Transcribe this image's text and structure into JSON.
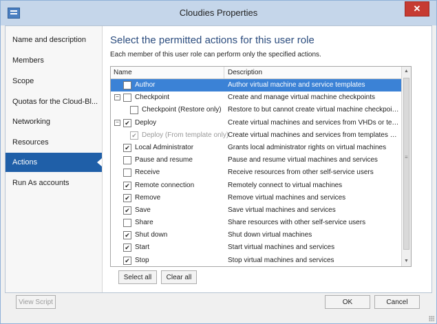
{
  "window": {
    "title": "Cloudies Properties"
  },
  "sidebar": {
    "items": [
      {
        "label": "Name and description",
        "active": false
      },
      {
        "label": "Members",
        "active": false
      },
      {
        "label": "Scope",
        "active": false
      },
      {
        "label": "Quotas for the Cloud-Bl...",
        "active": false
      },
      {
        "label": "Networking",
        "active": false
      },
      {
        "label": "Resources",
        "active": false
      },
      {
        "label": "Actions",
        "active": true
      },
      {
        "label": "Run As accounts",
        "active": false
      }
    ]
  },
  "main": {
    "heading": "Select the permitted actions for this user role",
    "subtext": "Each member of this user role can perform only the specified actions.",
    "table": {
      "columns": [
        "Name",
        "Description"
      ],
      "rows": [
        {
          "name": "Author",
          "description": "Author virtual machine and service templates",
          "checked": false,
          "selected": true
        },
        {
          "name": "Checkpoint",
          "description": "Create and manage virtual machine checkpoints",
          "checked": false,
          "expander": "minus"
        },
        {
          "name": "Checkpoint (Restore only)",
          "description": "Restore to but cannot create virtual machine checkpoints",
          "checked": false,
          "indent": true
        },
        {
          "name": "Deploy",
          "description": "Create virtual machines and services from VHDs or templat...",
          "checked": true,
          "expander": "minus"
        },
        {
          "name": "Deploy (From template only)",
          "description": "Create virtual machines and services from templates only",
          "checked": true,
          "indent": true,
          "disabled": true
        },
        {
          "name": "Local Administrator",
          "description": "Grants local administrator rights on virtual machines",
          "checked": true
        },
        {
          "name": "Pause and resume",
          "description": "Pause and resume virtual machines and services",
          "checked": false
        },
        {
          "name": "Receive",
          "description": "Receive resources from other self-service users",
          "checked": false
        },
        {
          "name": "Remote connection",
          "description": "Remotely connect to virtual machines",
          "checked": true
        },
        {
          "name": "Remove",
          "description": "Remove virtual machines and services",
          "checked": true
        },
        {
          "name": "Save",
          "description": "Save virtual machines and services",
          "checked": true
        },
        {
          "name": "Share",
          "description": "Share resources with other self-service users",
          "checked": false
        },
        {
          "name": "Shut down",
          "description": "Shut down virtual machines",
          "checked": true
        },
        {
          "name": "Start",
          "description": "Start virtual machines and services",
          "checked": true
        },
        {
          "name": "Stop",
          "description": "Stop virtual machines and services",
          "checked": true
        }
      ]
    },
    "select_all": "Select all",
    "clear_all": "Clear all"
  },
  "footer": {
    "view_script": "View Script",
    "ok": "OK",
    "cancel": "Cancel"
  },
  "icons": {
    "window": "window-app-icon",
    "close": "close-icon",
    "check": "check-icon",
    "collapse": "minus-expander-icon"
  }
}
